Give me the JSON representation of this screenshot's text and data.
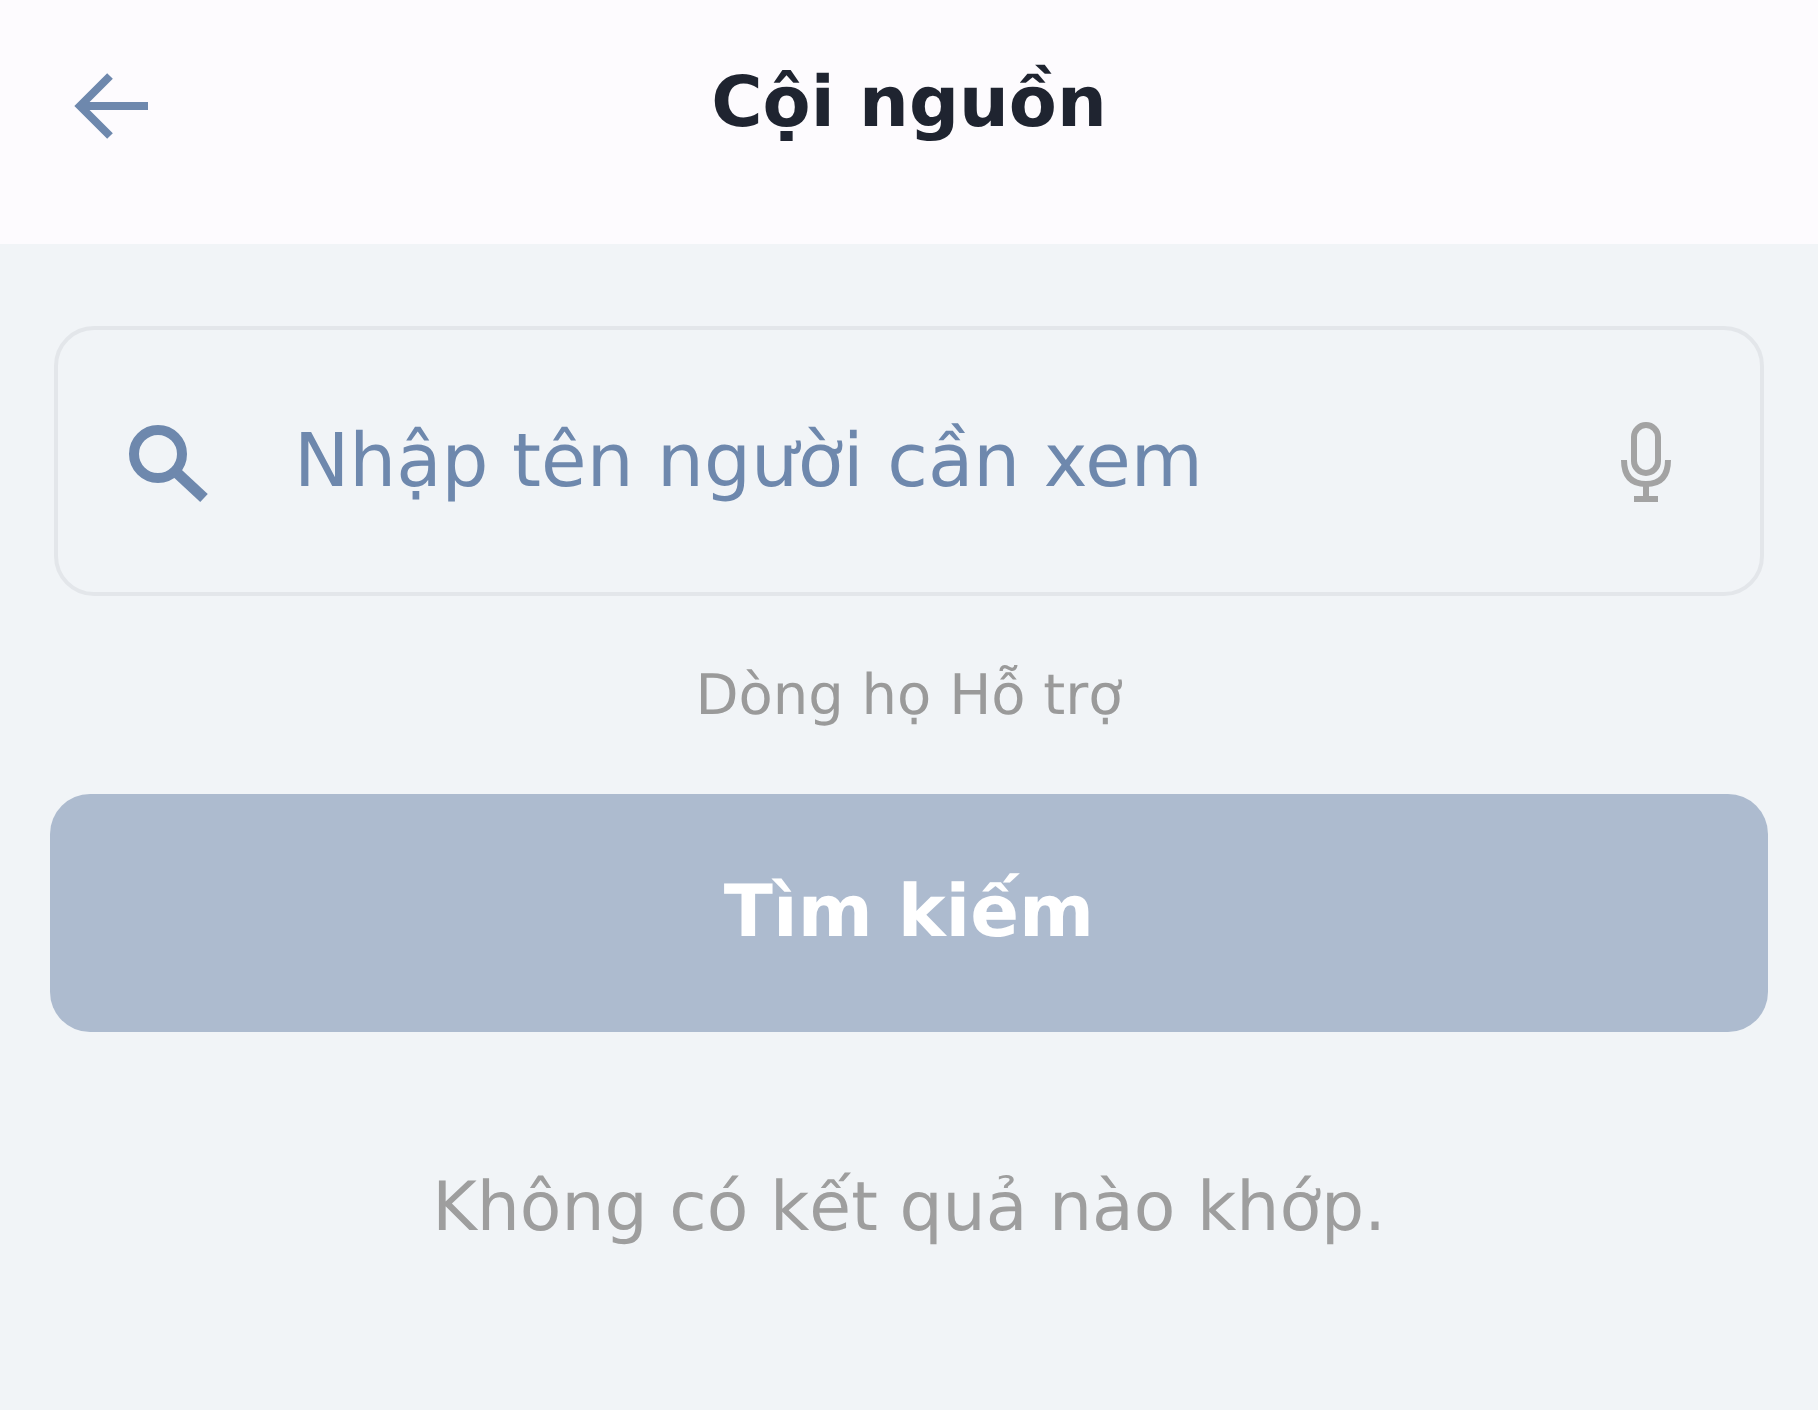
{
  "header": {
    "title": "Cội nguồn"
  },
  "search": {
    "placeholder": "Nhập tên người cần xem"
  },
  "scope_label": "Dòng họ Hỗ trợ",
  "search_button": {
    "label": "Tìm kiếm",
    "disabled": true
  },
  "empty_message": "Không có kết quả nào khớp."
}
